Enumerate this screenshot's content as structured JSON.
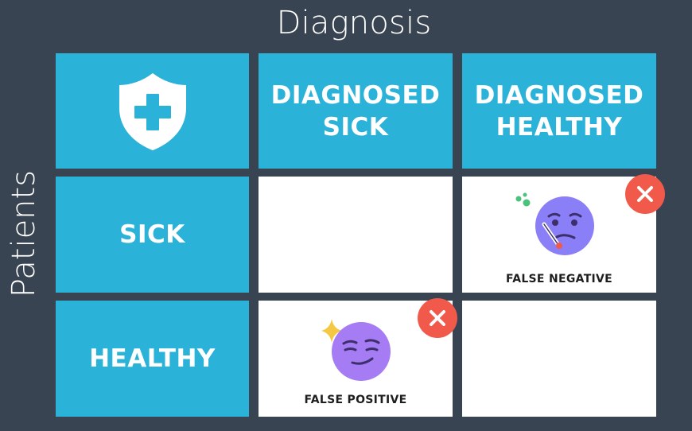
{
  "title_columns": "Diagnosis",
  "title_rows": "Patients",
  "corner": {
    "icon": "shield-plus-icon"
  },
  "columns": [
    "DIAGNOSED\nSICK",
    "DIAGNOSED\nHEALTHY"
  ],
  "rows": [
    "SICK",
    "HEALTHY"
  ],
  "cells": {
    "false_negative": {
      "label": "FALSE NEGATIVE",
      "icon": "sick-face-thermometer-icon",
      "badge": "x-icon"
    },
    "false_positive": {
      "label": "FALSE POSITIVE",
      "icon": "smirk-face-sparkle-icon",
      "badge": "x-icon"
    }
  },
  "colors": {
    "background": "#394452",
    "header_blue": "#2bb2d9",
    "cell_white": "#ffffff",
    "error_red": "#f15a4a",
    "face_purple": "#a57cf4",
    "sick_face": "#8a7ff7",
    "sparkle": "#f4c842",
    "germ_green": "#49c27a"
  }
}
